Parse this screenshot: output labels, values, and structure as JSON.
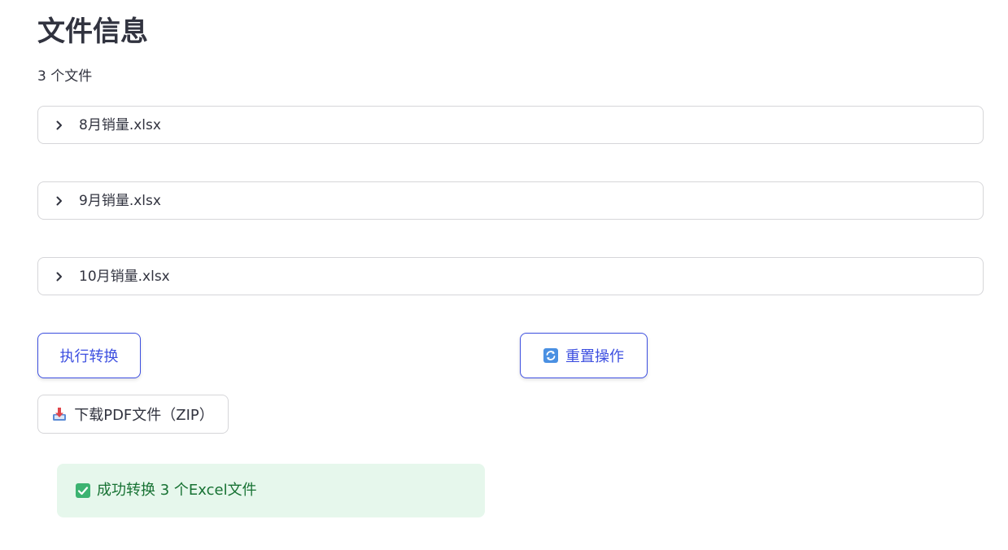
{
  "header": {
    "title": "文件信息",
    "file_count": "3 个文件"
  },
  "files": [
    {
      "name": "8月销量.xlsx"
    },
    {
      "name": "9月销量.xlsx"
    },
    {
      "name": "10月销量.xlsx"
    }
  ],
  "actions": {
    "convert_label": "执行转换",
    "reset_label": "重置操作",
    "reset_icon": "refresh-icon",
    "download_label": "下载PDF文件（ZIP）",
    "download_icon": "inbox-tray-icon"
  },
  "status": {
    "message": "成功转换 3 个Excel文件",
    "icon": "check-mark-icon"
  },
  "colors": {
    "accent": "#3d4fe0",
    "success_bg": "#e6f7ec",
    "success_text": "#177233",
    "text": "#31333f",
    "border": "#d6d6d9"
  }
}
